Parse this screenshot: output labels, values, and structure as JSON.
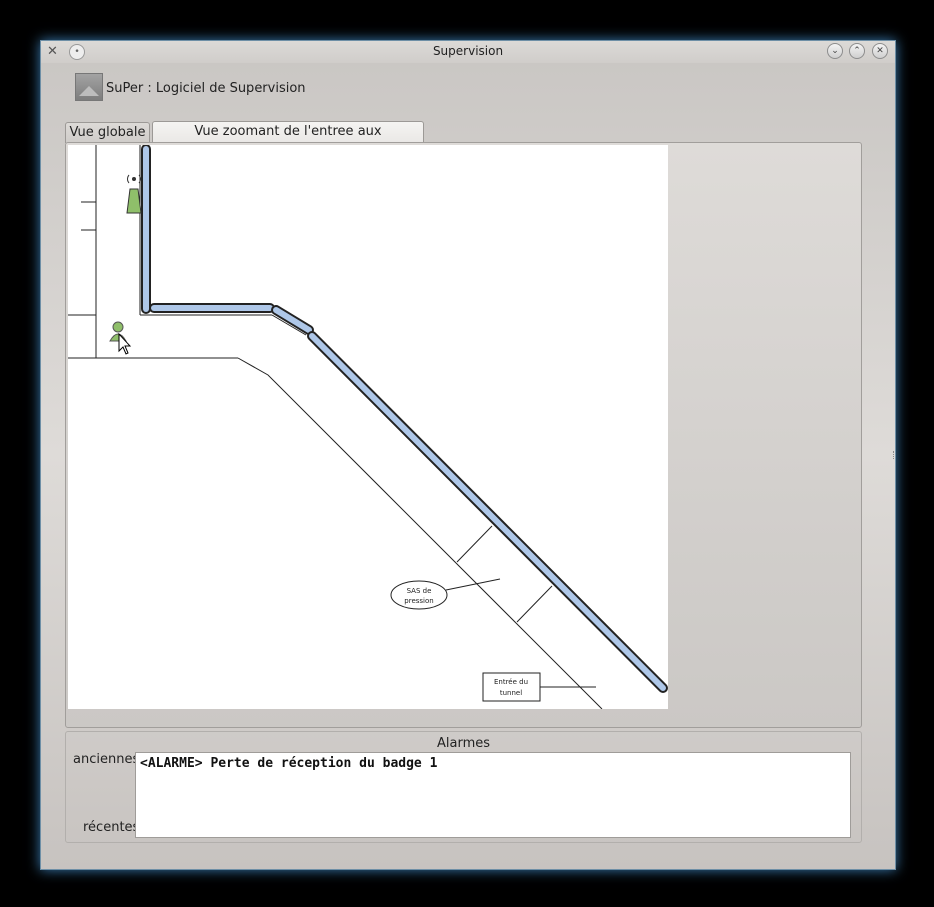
{
  "window": {
    "title": "Supervision"
  },
  "header": {
    "title": "SuPer : Logiciel de Supervision"
  },
  "tabs": [
    {
      "label": "Vue globale",
      "active": false
    },
    {
      "label": "Vue zoomant de l'entree aux dependances",
      "active": true
    }
  ],
  "map": {
    "labels": {
      "sas_line1": "SAS de",
      "sas_line2": "pression",
      "tunnel_line1": "Entrée du",
      "tunnel_line2": "tunnel"
    },
    "colors": {
      "pipe": "#aec7e8",
      "badge": "#8fbf6a"
    }
  },
  "alarms": {
    "title": "Alarmes",
    "older_label": "anciennes",
    "recent_label": "récentes",
    "messages": [
      "<ALARME> Perte de réception du badge 1"
    ]
  },
  "icons": {
    "app": "tools-icon",
    "menu": "circle-menu-icon",
    "minimize": "chevron-down-icon",
    "maximize": "chevron-up-icon",
    "close": "close-icon"
  }
}
